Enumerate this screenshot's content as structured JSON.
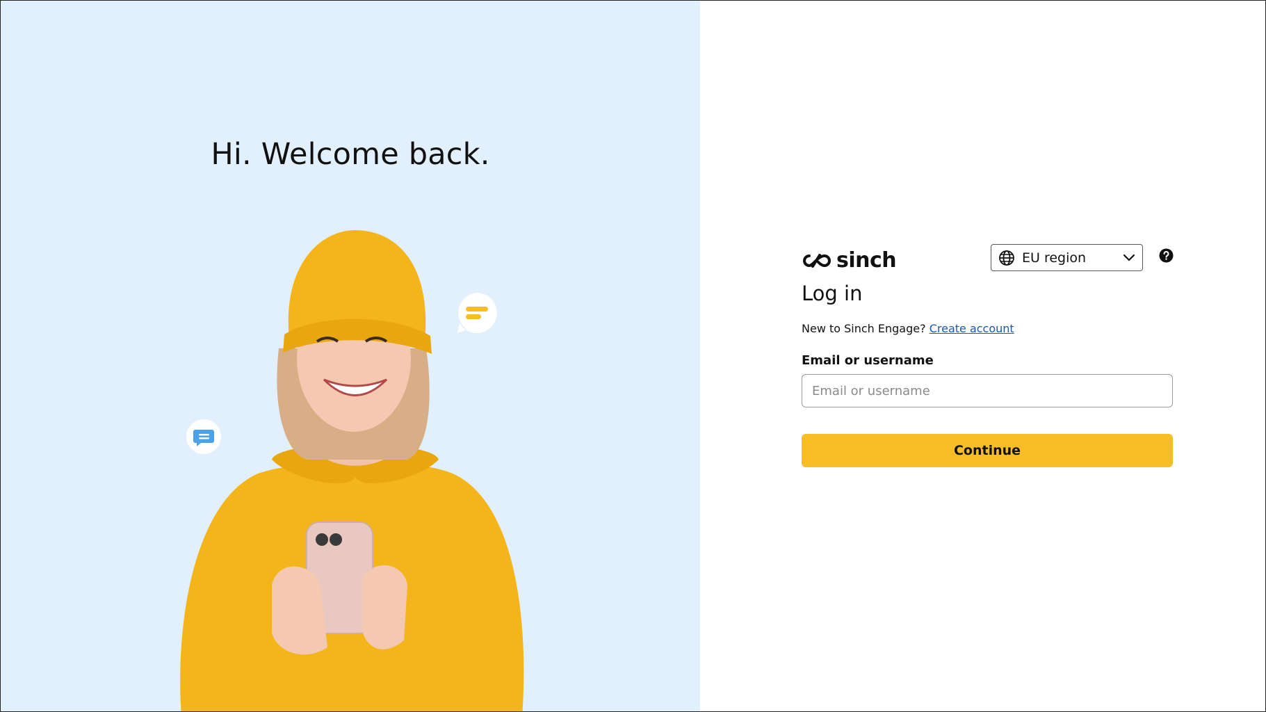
{
  "hero": {
    "heading": "Hi. Welcome back."
  },
  "brand": {
    "name": "sinch"
  },
  "region": {
    "selected": "EU region"
  },
  "login": {
    "title": "Log in",
    "new_prompt": "New to Sinch Engage?",
    "create_account": "Create account",
    "email_label": "Email or username",
    "email_placeholder": "Email or username",
    "email_value": "",
    "continue_label": "Continue"
  },
  "colors": {
    "left_bg": "#e1f0fc",
    "accent_yellow": "#f9bd28",
    "link_blue": "#1a5aa6"
  },
  "icons": [
    "chat-bubble-yellow-icon",
    "chat-bubble-blue-icon",
    "sinch-logo-icon",
    "globe-icon",
    "chevron-down-icon",
    "help-icon"
  ]
}
